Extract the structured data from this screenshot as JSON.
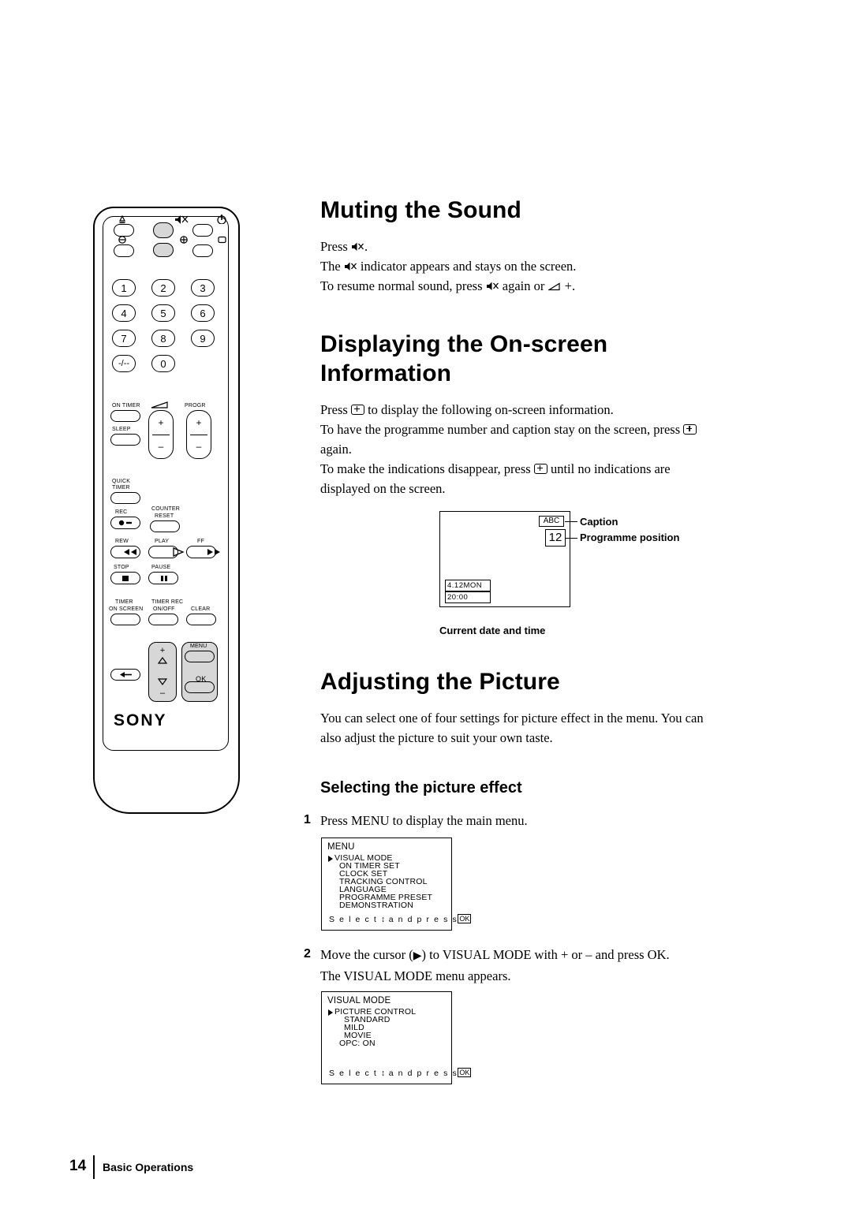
{
  "page": {
    "number": "14",
    "footer_section": "Basic Operations"
  },
  "sections": [
    {
      "id": "muting",
      "title": "Muting the Sound",
      "lines": [
        "Press  .",
        "The   indicator appears and stays on the screen.",
        "To resume normal sound, press   again or   +."
      ]
    },
    {
      "id": "onscreen",
      "title_line1": "Displaying the On-screen",
      "title_line2": "Information",
      "lines": [
        "Press   to display the following on-screen information.",
        "To have the programme number and caption stay on the screen, press",
        "again.",
        "To make the indications disappear, press   until no indications are",
        "displayed on the screen."
      ]
    },
    {
      "id": "picture",
      "title": "Adjusting the Picture",
      "lines": [
        "You can select one of four settings for picture effect in the menu.  You can",
        "also adjust the picture to suit your own taste."
      ],
      "subtitle": "Selecting the picture effect",
      "steps": [
        {
          "num": "1",
          "text": "Press MENU to display the main menu."
        },
        {
          "num": "2",
          "line1": "Move the cursor (",
          "line1b": ") to VISUAL MODE with +    or –    and press OK.",
          "line2": "The VISUAL MODE menu appears."
        }
      ]
    }
  ],
  "osd_diagram": {
    "caption_label": "Caption",
    "programme_label": "Programme position",
    "caption_value": "ABC",
    "programme_value": "12",
    "date_value": "4.12MON",
    "time_value": "20:00",
    "bottom_label": "Current date and time"
  },
  "menus": [
    {
      "id": "main-menu",
      "title": "MENU",
      "items": [
        "VISUAL MODE",
        "ON TIMER SET",
        "CLOCK SET",
        "TRACKING CONTROL",
        "LANGUAGE",
        "PROGRAMME PRESET",
        "DEMONSTRATION"
      ],
      "footer_prefix": "S e l e c t",
      "footer_mid": "a n d   p r e s s",
      "footer_ok": "OK"
    },
    {
      "id": "visual-mode-menu",
      "title": "VISUAL MODE",
      "items": [
        "PICTURE CONTROL",
        "STANDARD",
        "MILD",
        "MOVIE",
        "OPC:  ON"
      ],
      "footer_prefix": "S e l e c t",
      "footer_mid": "a n d   p r e s s",
      "footer_ok": "OK"
    }
  ],
  "remote": {
    "brand": "SONY",
    "numbers": [
      "1",
      "2",
      "3",
      "4",
      "5",
      "6",
      "7",
      "8",
      "9",
      "-/--",
      "0"
    ],
    "labels": {
      "on_timer": "ON TIMER",
      "sleep": "SLEEP",
      "progr": "PROGR",
      "quick_timer_1": "QUICK",
      "quick_timer_2": "TIMER",
      "counter": "COUNTER",
      "reset": "RESET",
      "rec": "REC",
      "rew": "REW",
      "play": "PLAY",
      "ff": "FF",
      "stop": "STOP",
      "pause": "PAUSE",
      "timer": "TIMER",
      "on_screen": "ON SCREEN",
      "timer_rec": "TIMER REC",
      "on_off": "ON/OFF",
      "clear": "CLEAR",
      "menu": "MENU",
      "ok": "OK"
    }
  }
}
